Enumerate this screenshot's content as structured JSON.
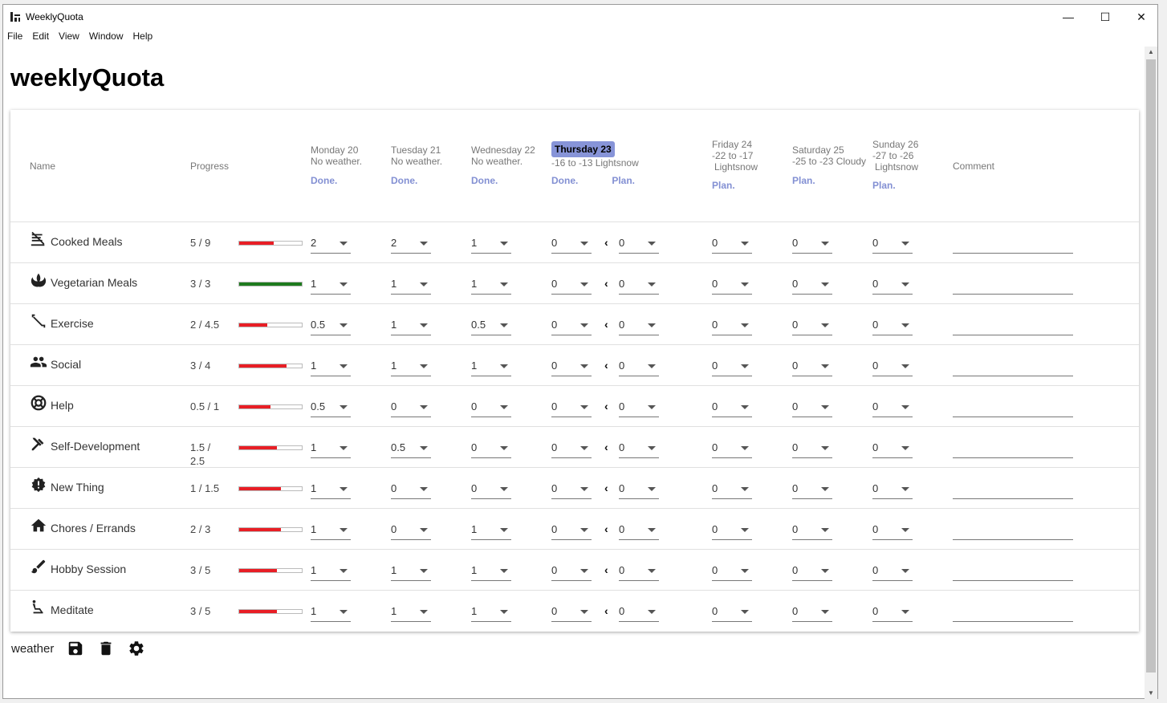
{
  "window": {
    "title": "WeeklyQuota",
    "minimize": "—",
    "maximize": "☐",
    "close": "✕"
  },
  "menu": [
    "File",
    "Edit",
    "View",
    "Window",
    "Help"
  ],
  "app_title": "weeklyQuota",
  "headers": {
    "name": "Name",
    "progress": "Progress",
    "comment": "Comment",
    "days": [
      {
        "day": "Monday 20",
        "weather": "No weather.",
        "mode": "Done."
      },
      {
        "day": "Tuesday 21",
        "weather": "No weather.",
        "mode": "Done."
      },
      {
        "day": "Wednesday 22",
        "weather": "No weather.",
        "mode": "Done."
      },
      {
        "day": "Thursday 23",
        "weather": "-16 to -13  Lightsnow",
        "mode_done": "Done.",
        "mode_plan": "Plan."
      },
      {
        "day": "Friday 24",
        "weather": "-22 to -17",
        "weather2": "Lightsnow",
        "mode": "Plan."
      },
      {
        "day": "Saturday 25",
        "weather": "-25 to -23  Cloudy",
        "mode": "Plan."
      },
      {
        "day": "Sunday 26",
        "weather": "-27 to -26",
        "weather2": "Lightsnow",
        "mode": "Plan."
      }
    ]
  },
  "rows": [
    {
      "name": "Cooked Meals",
      "icon": "no-meals-icon",
      "progress": "5 / 9",
      "fill": 0.556,
      "color": "#e81e25",
      "values": [
        "2",
        "2",
        "1",
        "0",
        "0",
        "0",
        "0",
        "0"
      ]
    },
    {
      "name": "Vegetarian Meals",
      "icon": "spa-icon",
      "progress": "3 / 3",
      "fill": 1.0,
      "color": "#1e7b1e",
      "values": [
        "1",
        "1",
        "1",
        "0",
        "0",
        "0",
        "0",
        "0"
      ]
    },
    {
      "name": "Exercise",
      "icon": "fitness-icon",
      "progress": "2 / 4.5",
      "fill": 0.444,
      "color": "#e81e25",
      "values": [
        "0.5",
        "1",
        "0.5",
        "0",
        "0",
        "0",
        "0",
        "0"
      ]
    },
    {
      "name": "Social",
      "icon": "people-icon",
      "progress": "3 / 4",
      "fill": 0.75,
      "color": "#e81e25",
      "values": [
        "1",
        "1",
        "1",
        "0",
        "0",
        "0",
        "0",
        "0"
      ]
    },
    {
      "name": "Help",
      "icon": "lifebuoy-icon",
      "progress": "0.5 / 1",
      "fill": 0.5,
      "color": "#e81e25",
      "values": [
        "0.5",
        "0",
        "0",
        "0",
        "0",
        "0",
        "0",
        "0"
      ]
    },
    {
      "name": "Self-Development",
      "icon": "tools-icon",
      "progress": "1.5 / 2.5",
      "fill": 0.6,
      "color": "#e81e25",
      "values": [
        "1",
        "0.5",
        "0",
        "0",
        "0",
        "0",
        "0",
        "0"
      ]
    },
    {
      "name": "New Thing",
      "icon": "new-releases-icon",
      "progress": "1 / 1.5",
      "fill": 0.667,
      "color": "#e81e25",
      "values": [
        "1",
        "0",
        "0",
        "0",
        "0",
        "0",
        "0",
        "0"
      ]
    },
    {
      "name": "Chores / Errands",
      "icon": "home-icon",
      "progress": "2 / 3",
      "fill": 0.667,
      "color": "#e81e25",
      "values": [
        "1",
        "0",
        "1",
        "0",
        "0",
        "0",
        "0",
        "0"
      ]
    },
    {
      "name": "Hobby Session",
      "icon": "brush-icon",
      "progress": "3 / 5",
      "fill": 0.6,
      "color": "#e81e25",
      "values": [
        "1",
        "1",
        "1",
        "0",
        "0",
        "0",
        "0",
        "0"
      ]
    },
    {
      "name": "Meditate",
      "icon": "seat-icon",
      "progress": "3 / 5",
      "fill": 0.6,
      "color": "#e81e25",
      "values": [
        "1",
        "1",
        "1",
        "0",
        "0",
        "0",
        "0",
        "0"
      ]
    }
  ],
  "bottom": {
    "weather_label": "weather"
  }
}
